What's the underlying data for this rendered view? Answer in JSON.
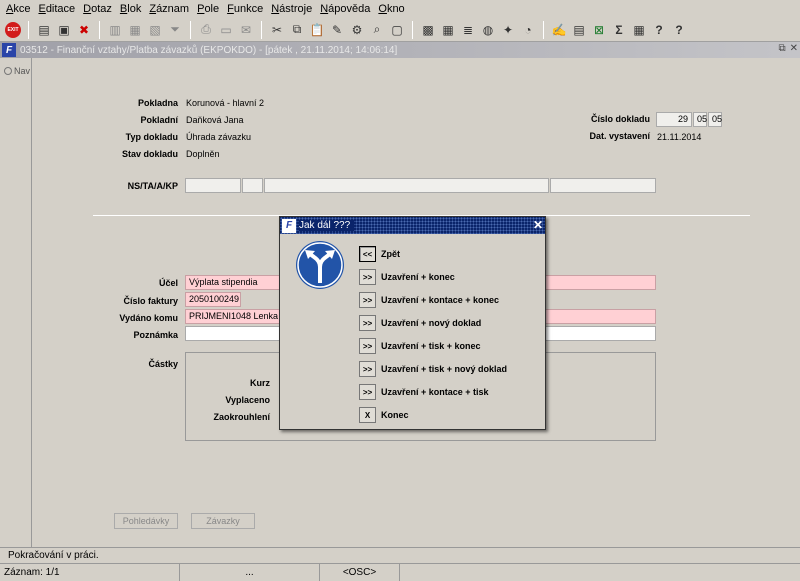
{
  "menu": [
    "Akce",
    "Editace",
    "Dotaz",
    "Blok",
    "Záznam",
    "Pole",
    "Funkce",
    "Nástroje",
    "Nápověda",
    "Okno"
  ],
  "toolbar": {
    "exit_label": "EXIT"
  },
  "window": {
    "title": "03512 - Finanční vztahy/Platba závazků (EKPOKDO) - [pátek , 21.11.2014; 14:06:14]",
    "restore_glyph": "⧉",
    "close_glyph": "✕"
  },
  "nav": {
    "label": "Nav"
  },
  "form": {
    "pokladna_label": "Pokladna",
    "pokladna_value": "Korunová - hlavní 2",
    "pokladni_label": "Pokladní",
    "pokladni_value": "Daňková Jana",
    "typ_label": "Typ dokladu",
    "typ_value": "Úhrada závazku",
    "stav_label": "Stav dokladu",
    "stav_value": "Doplněn",
    "cislo_label": "Číslo dokladu",
    "cislo_1": "29",
    "cislo_2": "05",
    "cislo_3": "05",
    "datum_label": "Dat. vystavení",
    "datum_value": "21.11.2014",
    "ns_label": "NS/TA/A/KP",
    "ucel_label": "Účel",
    "ucel_value": "Výplata stipendia",
    "faktura_label": "Číslo faktury",
    "faktura_value": "2050100249",
    "vydano_label": "Vydáno komu",
    "vydano_value": "PRIJMENI1048 Lenka",
    "poznamka_label": "Poznámka",
    "poznamka_value": "",
    "castky_label": "Částky",
    "kurz_label": "Kurz",
    "vyplaceno_label": "Vyplaceno",
    "zaokrouhleni_label": "Zaokrouhlení",
    "pohledavky_button": "Pohledávky",
    "zavazky_button": "Závazky"
  },
  "dialog": {
    "title": "Jak dál ???",
    "close_glyph": "✕",
    "options": [
      {
        "btn": "<<",
        "label": "Zpět"
      },
      {
        "btn": ">>",
        "label": "Uzavření + konec"
      },
      {
        "btn": ">>",
        "label": "Uzavření + kontace + konec"
      },
      {
        "btn": ">>",
        "label": "Uzavření + nový doklad"
      },
      {
        "btn": ">>",
        "label": "Uzavření + tisk + konec"
      },
      {
        "btn": ">>",
        "label": "Uzavření + tisk + nový doklad"
      },
      {
        "btn": ">>",
        "label": "Uzavření + kontace + tisk"
      },
      {
        "btn": "X",
        "label": "Konec"
      }
    ]
  },
  "status": {
    "message": "Pokračování v práci.",
    "record": "Záznam: 1/1",
    "dots": "...",
    "mode": "<OSC>"
  },
  "colors": {
    "sign_blue": "#2254a8",
    "dialog_title_bg": "#0a246a",
    "required_pink": "#ffd0d4"
  }
}
